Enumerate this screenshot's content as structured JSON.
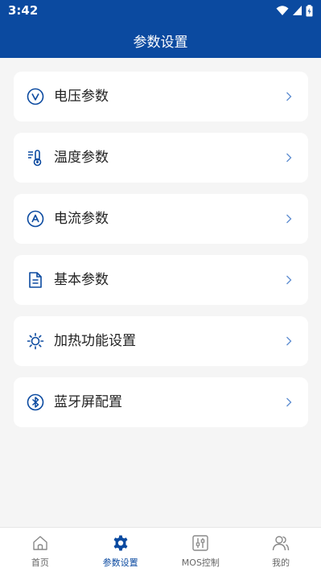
{
  "status_bar": {
    "time": "3:42"
  },
  "header": {
    "title": "参数设置"
  },
  "menu": [
    {
      "label": "电压参数",
      "icon": "voltage-icon"
    },
    {
      "label": "温度参数",
      "icon": "thermometer-icon"
    },
    {
      "label": "电流参数",
      "icon": "current-icon"
    },
    {
      "label": "基本参数",
      "icon": "document-icon"
    },
    {
      "label": "加热功能设置",
      "icon": "sun-icon"
    },
    {
      "label": "蓝牙屏配置",
      "icon": "bluetooth-icon"
    }
  ],
  "tabs": [
    {
      "label": "首页",
      "icon": "home-icon",
      "active": false
    },
    {
      "label": "参数设置",
      "icon": "gear-icon",
      "active": true
    },
    {
      "label": "MOS控制",
      "icon": "sliders-icon",
      "active": false
    },
    {
      "label": "我的",
      "icon": "users-icon",
      "active": false
    }
  ],
  "colors": {
    "primary": "#0b4aa0",
    "background": "#f5f5f5",
    "card": "#ffffff"
  }
}
